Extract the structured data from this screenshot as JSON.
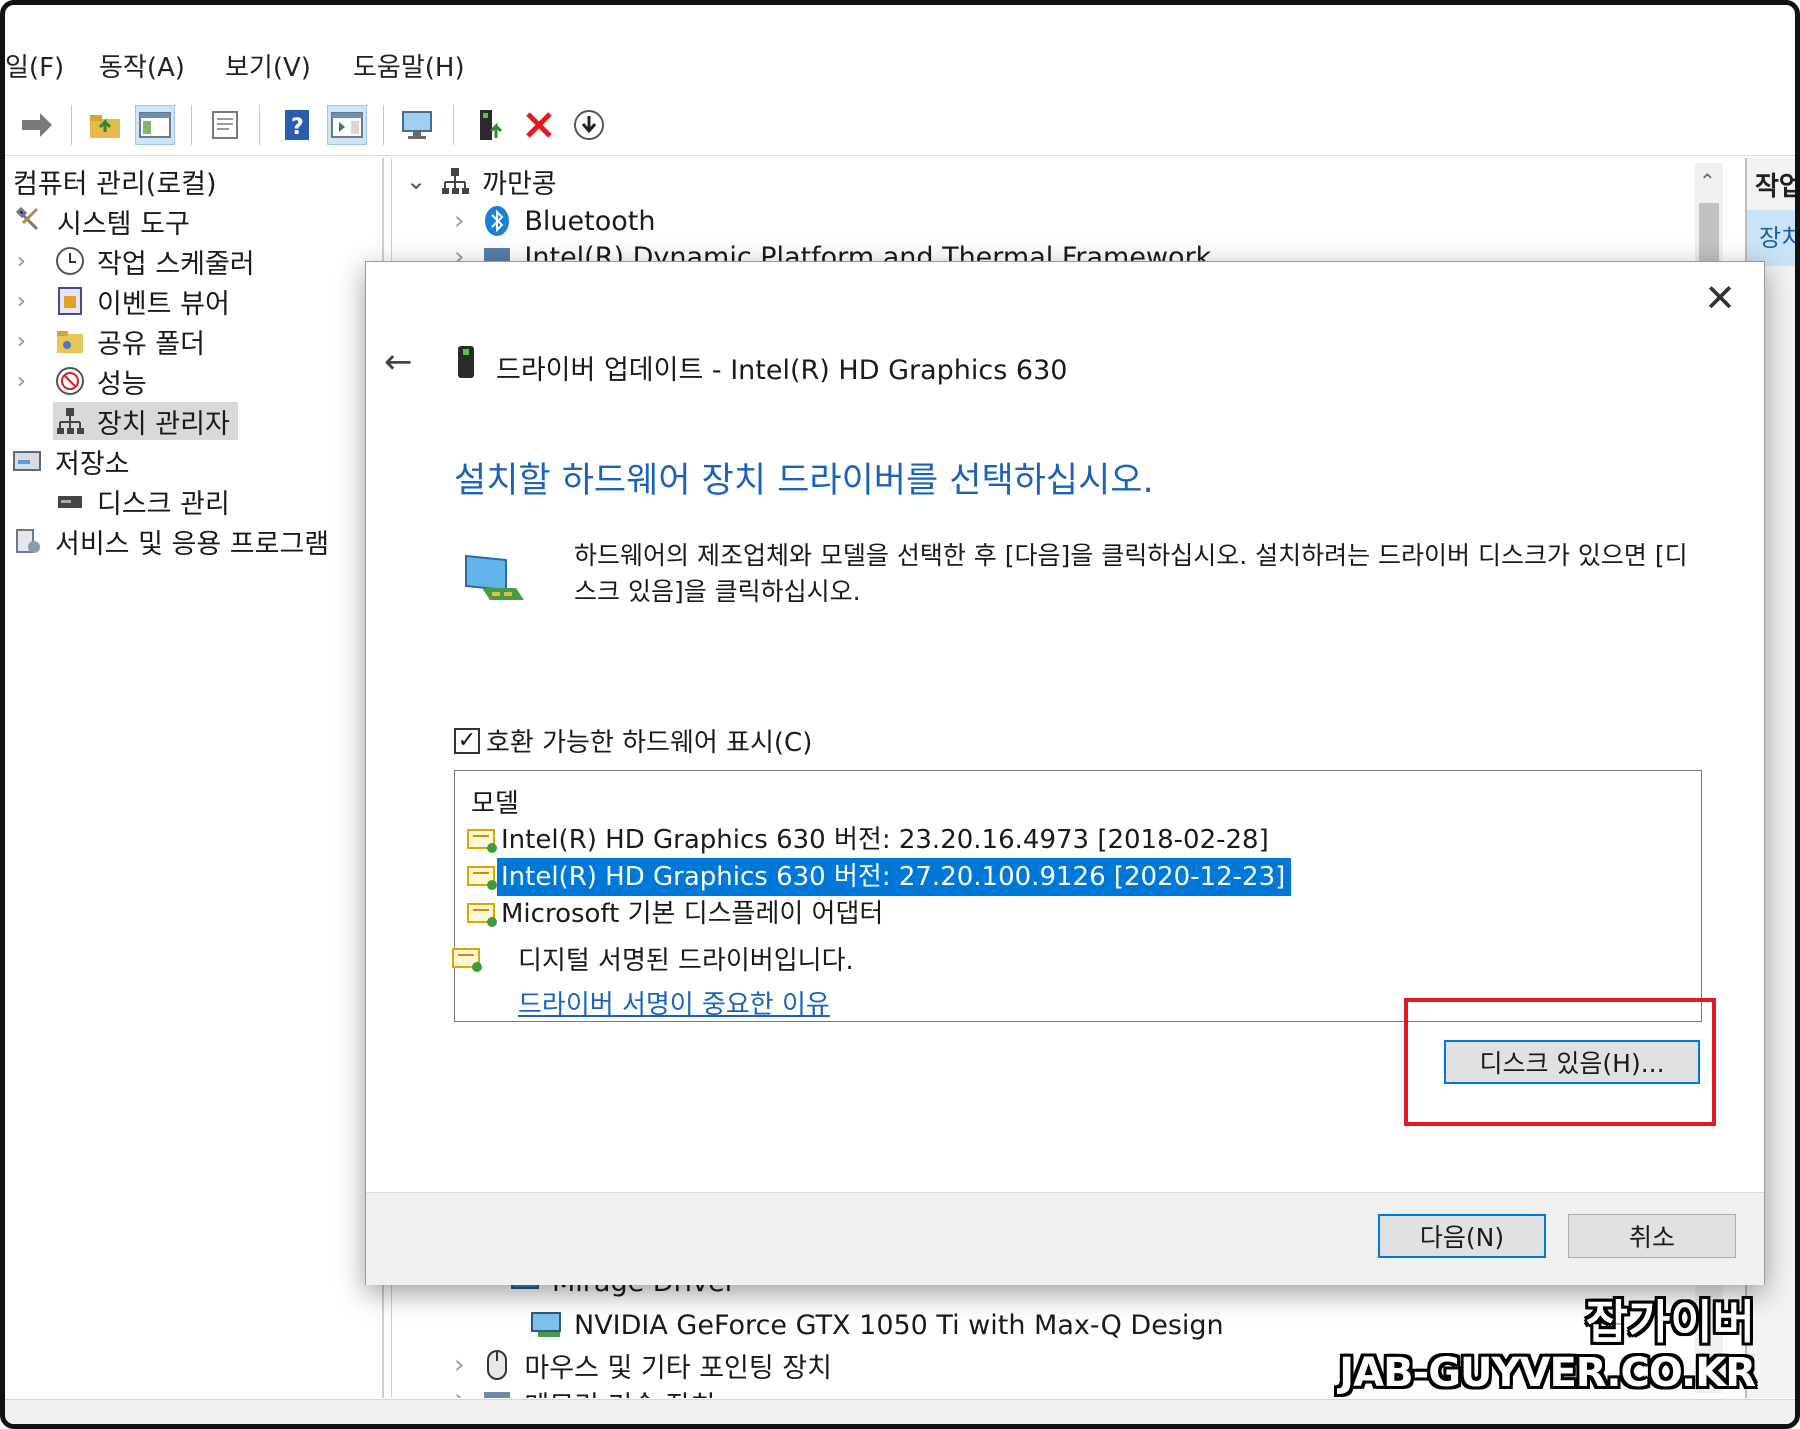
{
  "menu": {
    "file": "일(F)",
    "action": "동작(A)",
    "view": "보기(V)",
    "help": "도움말(H)"
  },
  "tree": {
    "root": "컴퓨터 관리(로컬)",
    "system_tools": "시스템 도구",
    "task_scheduler": "작업 스케줄러",
    "event_viewer": "이벤트 뷰어",
    "shared_folders": "공유 폴더",
    "performance": "성능",
    "device_manager": "장치 관리자",
    "storage": "저장소",
    "disk_management": "디스크 관리",
    "services": "서비스 및 응용 프로그램"
  },
  "devices": {
    "computer": "까만콩",
    "bluetooth": "Bluetooth",
    "intel_dptf": "Intel(R) Dynamic Platform and Thermal Framework",
    "mirage": "Mirage Driver",
    "nvidia": "NVIDIA GeForce GTX 1050 Ti with Max-Q Design",
    "mouse": "마우스 및 기타 포인팅 장치",
    "memory": "메모리 기술 장치"
  },
  "actions": {
    "header": "작업",
    "item": "장치"
  },
  "dialog": {
    "title": "드라이버 업데이트 - Intel(R) HD Graphics 630",
    "heading": "설치할 하드웨어 장치 드라이버를 선택하십시오.",
    "description": "하드웨어의 제조업체와 모델을 선택한 후 [다음]을 클릭하십시오. 설치하려는 드라이버 디스크가 있으면 [디스크 있음]을 클릭하십시오.",
    "compatible_label": "호환 가능한 하드웨어 표시(C)",
    "compatible_checked": true,
    "list_header": "모델",
    "models": [
      "Intel(R) HD Graphics 630 버전: 23.20.16.4973 [2018-02-28]",
      "Intel(R) HD Graphics 630 버전: 27.20.100.9126 [2020-12-23]",
      "Microsoft 기본 디스플레이 어댑터"
    ],
    "selected_index": 1,
    "signed_text": "디지털 서명된 드라이버입니다.",
    "signing_link": "드라이버 서명이 중요한 이유",
    "have_disk": "디스크 있음(H)...",
    "next": "다음(N)",
    "cancel": "취소"
  },
  "watermark": {
    "line1": "잡가이버",
    "line2": "JAB-GUYVER.CO.KR"
  },
  "colors": {
    "accent": "#0078d7",
    "heading": "#1a63b8",
    "highlight_box": "#e11b22"
  }
}
